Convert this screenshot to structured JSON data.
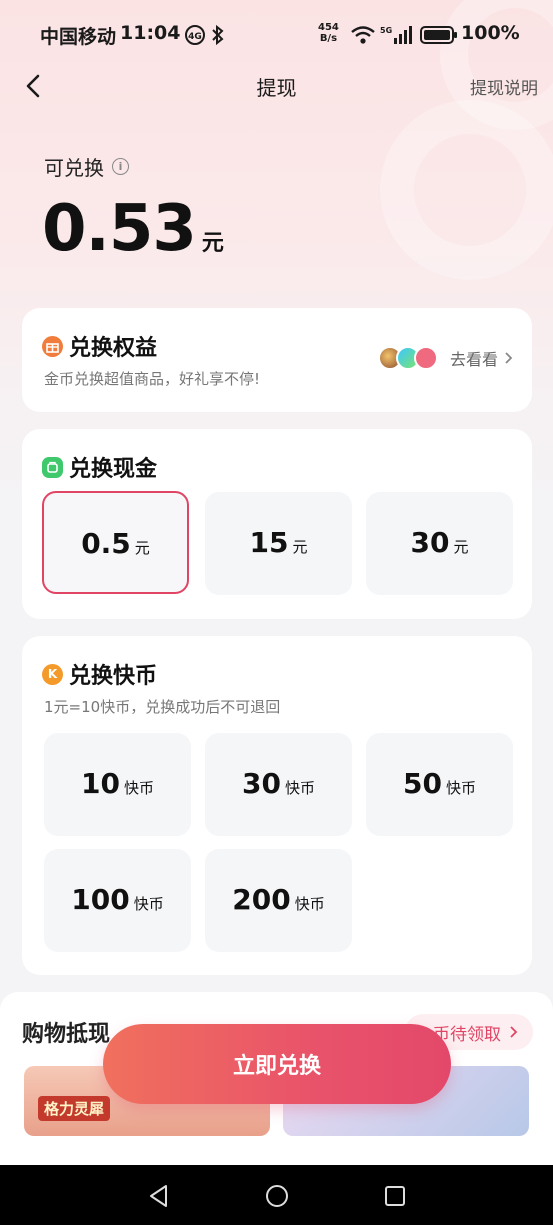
{
  "status_bar": {
    "carrier": "中国移动",
    "time": "11:04",
    "net_speed_value": "454",
    "net_speed_unit": "B/s",
    "battery": "100%"
  },
  "nav": {
    "title": "提现",
    "help": "提现说明"
  },
  "balance": {
    "label": "可兑换",
    "amount": "0.53",
    "unit": "元"
  },
  "benefits": {
    "title": "兑换权益",
    "subtitle": "金币兑换超值商品，好礼享不停!",
    "link": "去看看"
  },
  "cash": {
    "title": "兑换现金",
    "options": [
      {
        "value": "0.5",
        "unit": "元",
        "selected": true
      },
      {
        "value": "15",
        "unit": "元",
        "selected": false
      },
      {
        "value": "30",
        "unit": "元",
        "selected": false
      }
    ]
  },
  "kuaibi": {
    "title": "兑换快币",
    "badge": "K",
    "rate": "1元=10快币，兑换成功后不可退回",
    "options": [
      {
        "value": "10",
        "unit": "快币"
      },
      {
        "value": "30",
        "unit": "快币"
      },
      {
        "value": "50",
        "unit": "快币"
      },
      {
        "value": "100",
        "unit": "快币"
      },
      {
        "value": "200",
        "unit": "快币"
      }
    ]
  },
  "shopping": {
    "title": "购物抵现",
    "pill": "币待领取",
    "banner_text": "格力灵犀"
  },
  "cta": {
    "label": "立即兑换"
  },
  "colors": {
    "accent": "#e04565",
    "cta_start": "#f0705d",
    "cta_end": "#e3486a"
  }
}
